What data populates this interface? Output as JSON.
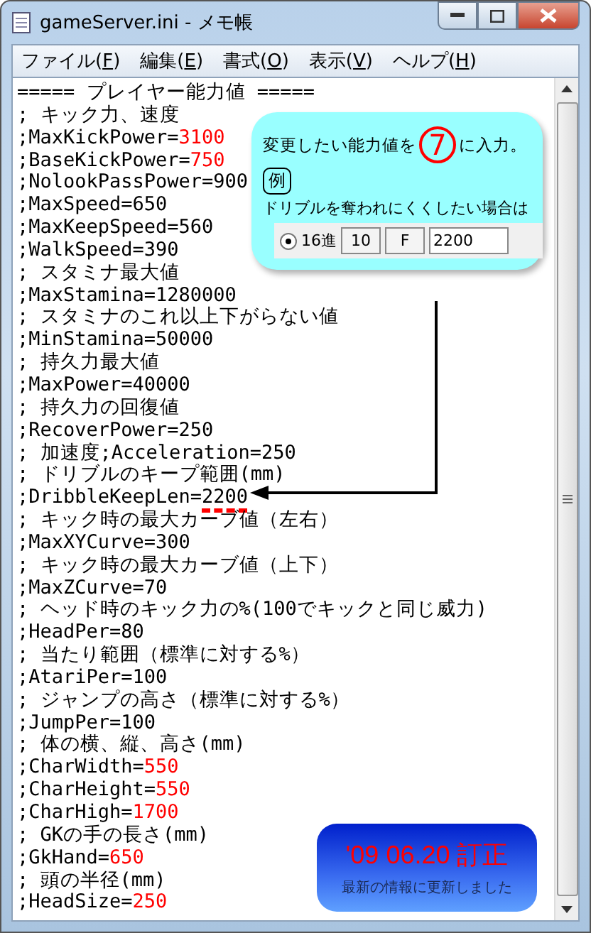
{
  "window": {
    "title": "gameServer.ini - メモ帳"
  },
  "menu": [
    {
      "label": "ファイル(",
      "key": "F",
      "end": ")"
    },
    {
      "label": "編集(",
      "key": "E",
      "end": ")"
    },
    {
      "label": "書式(",
      "key": "O",
      "end": ")"
    },
    {
      "label": "表示(",
      "key": "V",
      "end": ")"
    },
    {
      "label": "ヘルプ(",
      "key": "H",
      "end": ")"
    }
  ],
  "lines": [
    {
      "text": "===== プレイヤー能力値 ====="
    },
    {
      "text": "; キック力、速度"
    },
    {
      "text": ";MaxKickPower=",
      "value": "3100",
      "highlighted": true
    },
    {
      "text": ";BaseKickPower=",
      "value": "750",
      "highlighted": true
    },
    {
      "text": ";NolookPassPower=900"
    },
    {
      "text": ";MaxSpeed=650"
    },
    {
      "text": ";MaxKeepSpeed=560"
    },
    {
      "text": ";WalkSpeed=390"
    },
    {
      "text": "; スタミナ最大値"
    },
    {
      "text": ";MaxStamina=1280000"
    },
    {
      "text": "; スタミナのこれ以上下がらない値"
    },
    {
      "text": ";MinStamina=50000"
    },
    {
      "text": "; 持久力最大値"
    },
    {
      "text": ";MaxPower=40000"
    },
    {
      "text": "; 持久力の回復値"
    },
    {
      "text": ";RecoverPower=250"
    },
    {
      "text": "; 加速度;Acceleration=250"
    },
    {
      "text": "; ドリブルのキープ範囲(mm)"
    },
    {
      "text": ";DribbleKeepLen=",
      "value": "2200",
      "highlighted": false,
      "marked": true
    },
    {
      "text": "; キック時の最大カーブ値（左右）"
    },
    {
      "text": ";MaxXYCurve=300"
    },
    {
      "text": "; キック時の最大カーブ値（上下）"
    },
    {
      "text": ";MaxZCurve=70"
    },
    {
      "text": "; ヘッド時のキック力の%(100でキックと同じ威力)"
    },
    {
      "text": ";HeadPer=80"
    },
    {
      "text": "; 当たり範囲（標準に対する%）"
    },
    {
      "text": ";AtariPer=100"
    },
    {
      "text": "; ジャンプの高さ（標準に対する%）"
    },
    {
      "text": ";JumpPer=100"
    },
    {
      "text": "; 体の横、縦、高さ(mm)"
    },
    {
      "text": ";CharWidth=",
      "value": "550",
      "highlighted": true
    },
    {
      "text": ";CharHeight=",
      "value": "550",
      "highlighted": true
    },
    {
      "text": ";CharHigh=",
      "value": "1700",
      "highlighted": true
    },
    {
      "text": "; GKの手の長さ(mm)"
    },
    {
      "text": ";GkHand=",
      "value": "650",
      "highlighted": true
    },
    {
      "text": "; 頭の半径(mm)"
    },
    {
      "text": ";HeadSize=",
      "value": "250",
      "highlighted": true
    }
  ],
  "callout": {
    "before": "変更したい能力値を",
    "number": "7",
    "after": "に入力。",
    "example": "例",
    "note": "ドリブルを奪われにくくしたい場合は",
    "toolbar": {
      "radio": {
        "label": "16進",
        "selected": true
      },
      "buttons": [
        "10",
        "F"
      ],
      "field": "2200"
    }
  },
  "badge": {
    "title": "'09 06.20 訂正",
    "subtitle": "最新の情報に更新しました"
  }
}
